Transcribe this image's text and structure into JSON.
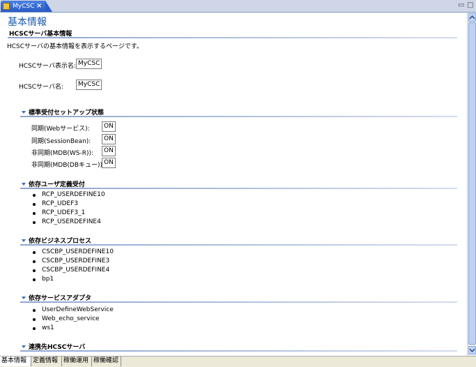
{
  "tab": {
    "title": "MyCSC",
    "close": "×"
  },
  "window_controls": {
    "minimize": "▭",
    "maximize": "□"
  },
  "page": {
    "title": "基本情報"
  },
  "basic": {
    "heading": "HCSCサーバ基本情報",
    "description": "HCSCサーバの基本情報を表示するページです。",
    "display_name_label": "HCSCサーバ表示名:",
    "display_name_value": "MyCSC",
    "name_label": "HCSCサーバ名:",
    "name_value": "MyCSC"
  },
  "setup": {
    "heading": "標準受付セットアップ状態",
    "rows": [
      {
        "label": "同期(Webサービス):",
        "value": "ON"
      },
      {
        "label": "同期(SessionBean):",
        "value": "ON"
      },
      {
        "label": "非同期(MDB(WS-R)):",
        "value": "ON"
      },
      {
        "label": "非同期(MDB(DBキュー)):",
        "value": "ON"
      }
    ]
  },
  "user_defined": {
    "heading": "依存ユーザ定義受付",
    "items": [
      "RCP_USERDEFINE10",
      "RCP_UDEF3",
      "RCP_UDEF3_1",
      "RCP_USERDEFINE4"
    ]
  },
  "business_process": {
    "heading": "依存ビジネスプロセス",
    "items": [
      "CSCBP_USERDEFINE10",
      "CSCBP_USERDEFINE3",
      "CSCBP_USERDEFINE4",
      "bp1"
    ]
  },
  "service_adapter": {
    "heading": "依存サービスアダプタ",
    "items": [
      "UserDefineWebService",
      "Web_echo_service",
      "ws1"
    ]
  },
  "linked": {
    "heading": "連携先HCSCサーバ"
  },
  "bottom_tabs": [
    "基本情報",
    "定義情報",
    "稼働運用",
    "稼働確認"
  ],
  "colors": {
    "title": "#1b5bab",
    "tab_active": "#2b5cc8",
    "rule": "#8ca5cf"
  }
}
